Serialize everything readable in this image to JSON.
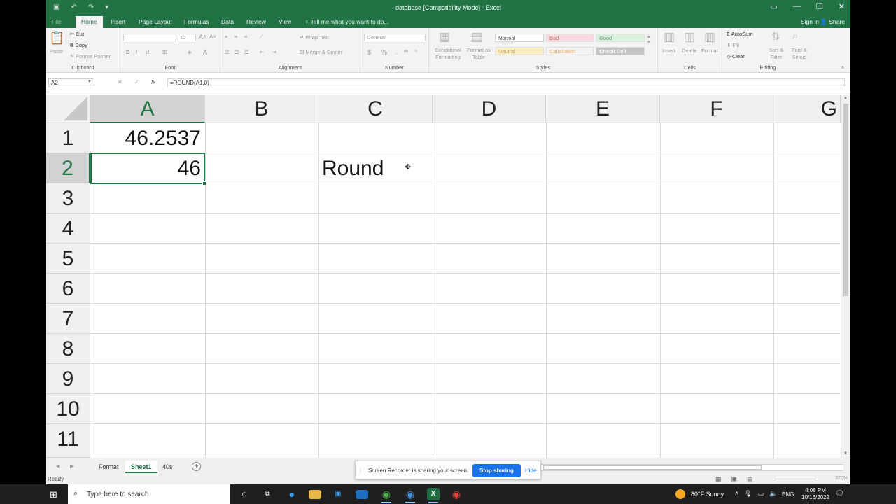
{
  "window": {
    "title": "database  [Compatibility Mode]  -  Excel",
    "controls": [
      "restore-ribbon-icon",
      "minimize-icon",
      "maximize-icon",
      "close-icon"
    ]
  },
  "tabs": {
    "file": "File",
    "items": [
      "Home",
      "Insert",
      "Page Layout",
      "Formulas",
      "Data",
      "Review",
      "View"
    ],
    "active": "Home",
    "tell_me": "Tell me what you want to do...",
    "sign_in": "Sign in",
    "share": "Share"
  },
  "ribbon": {
    "clipboard": {
      "label": "Clipboard",
      "paste": "Paste",
      "cut": "Cut",
      "copy": "Copy",
      "format_painter": "Format Painter"
    },
    "font": {
      "label": "Font",
      "size": "10",
      "bold": "B",
      "italic": "I",
      "underline": "U"
    },
    "alignment": {
      "label": "Alignment",
      "wrap_text": "Wrap Text",
      "merge_center": "Merge & Center"
    },
    "number": {
      "label": "Number",
      "format": "General",
      "currency": "$",
      "percent": "%"
    },
    "styles": {
      "label": "Styles",
      "conditional": "Conditional Formatting",
      "format_table": "Format as Table",
      "cells": [
        "Normal",
        "Bad",
        "Good",
        "Neutral",
        "Calculation",
        "Check Cell"
      ]
    },
    "cells": {
      "label": "Cells",
      "insert": "Insert",
      "delete": "Delete",
      "format": "Format"
    },
    "editing": {
      "label": "Editing",
      "autosum": "AutoSum",
      "fill": "Fill",
      "clear": "Clear",
      "sort_filter": "Sort & Filter",
      "find_select": "Find & Select"
    }
  },
  "formula_bar": {
    "name_box": "A2",
    "formula": "=ROUND(A1,0)"
  },
  "grid": {
    "columns": [
      "A",
      "B",
      "C",
      "D",
      "E",
      "F",
      "G"
    ],
    "rows": [
      "1",
      "2",
      "3",
      "4",
      "5",
      "6",
      "7",
      "8",
      "9",
      "10",
      "11"
    ],
    "selected_column": "A",
    "selected_row": "2",
    "cells": {
      "A1": "46.2537",
      "A2": "46",
      "C2": "Round"
    }
  },
  "sheets": {
    "tabs": [
      "Format",
      "Sheet1",
      "40s"
    ],
    "active": "Sheet1"
  },
  "share_notice": {
    "message": "Screen Recorder is sharing your screen.",
    "stop": "Stop sharing",
    "hide": "Hide"
  },
  "status": {
    "ready": "Ready",
    "zoom": "370%"
  },
  "taskbar": {
    "search_placeholder": "Type here to search",
    "weather": "80°F  Sunny",
    "language": "ENG",
    "time": "4:08 PM",
    "date": "10/16/2022"
  },
  "colors": {
    "excel_green": "#217346",
    "accent_blue": "#1a73e8"
  }
}
